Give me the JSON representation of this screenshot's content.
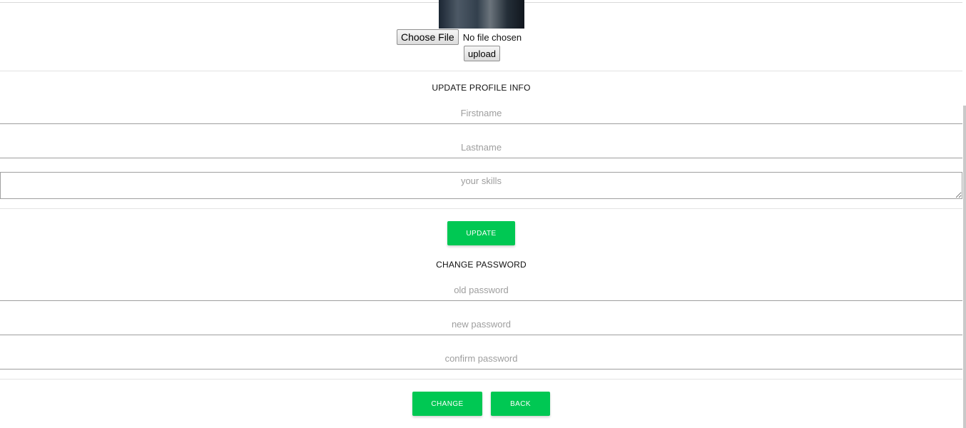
{
  "upload": {
    "choose_label": "Choose File",
    "file_status": "No file chosen",
    "upload_label": "upload"
  },
  "profile": {
    "title": "UPDATE PROFILE INFO",
    "firstname_placeholder": "Firstname",
    "lastname_placeholder": "Lastname",
    "skills_placeholder": "your skills",
    "update_label": "UPDATE"
  },
  "password": {
    "title": "CHANGE PASSWORD",
    "old_placeholder": "old password",
    "new_placeholder": "new password",
    "confirm_placeholder": "confirm password",
    "change_label": "CHANGE",
    "back_label": "BACK"
  },
  "colors": {
    "accent": "#00c853"
  }
}
